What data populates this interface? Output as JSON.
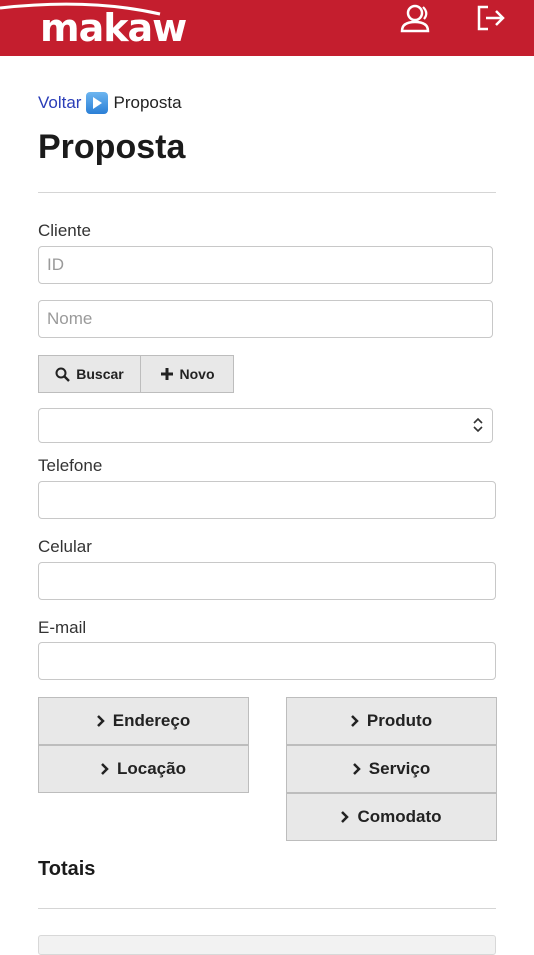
{
  "header": {
    "logo_text": "makaw",
    "brand_color": "#c41e2e",
    "user_icon": "user-icon",
    "logout_icon": "logout-icon"
  },
  "breadcrumb": {
    "back_label": "Voltar",
    "separator_icon": "play-icon",
    "current": "Proposta"
  },
  "page_title": "Proposta",
  "cliente": {
    "label": "Cliente",
    "id_placeholder": "ID",
    "nome_placeholder": "Nome",
    "buscar_label": "Buscar",
    "novo_label": "Novo",
    "select_value": ""
  },
  "telefone": {
    "label": "Telefone",
    "value": ""
  },
  "celular": {
    "label": "Celular",
    "value": ""
  },
  "email": {
    "label": "E-mail",
    "value": ""
  },
  "sections": {
    "endereco": "Endereço",
    "locacao": "Locação",
    "produto": "Produto",
    "servico": "Serviço",
    "comodato": "Comodato"
  },
  "totals_title": "Totais"
}
